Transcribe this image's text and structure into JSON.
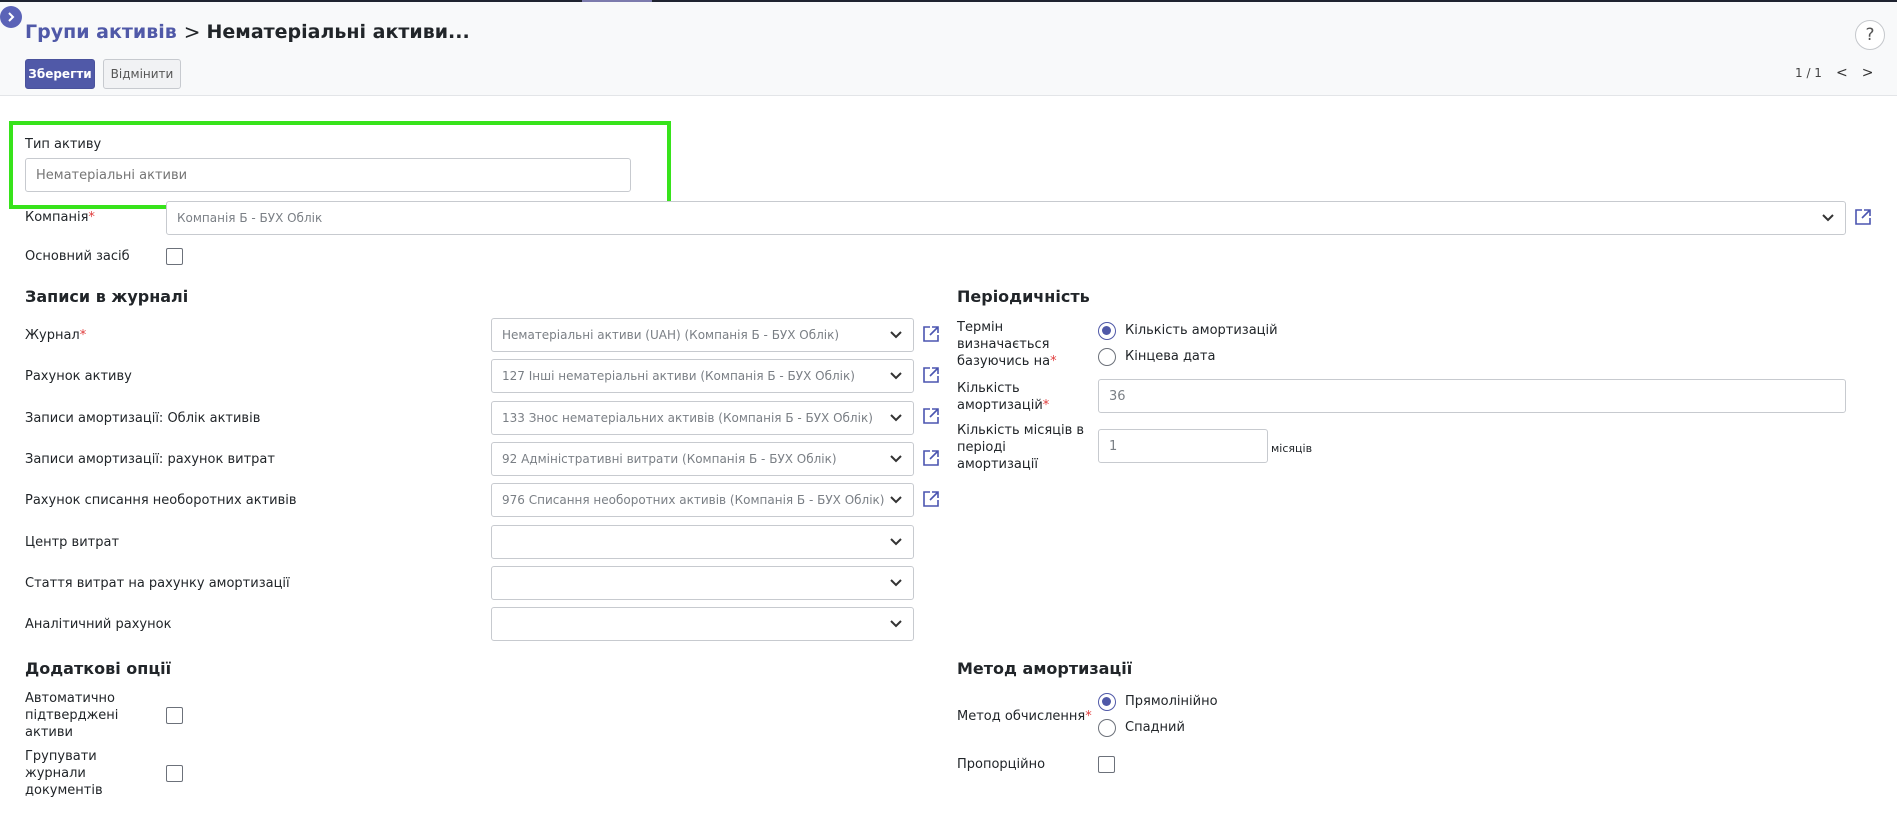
{
  "breadcrumb": {
    "parent": "Групи активів",
    "separator": ">",
    "current": "Нематеріальні активи..."
  },
  "help": "?",
  "toolbar": {
    "save_label": "Зберегти",
    "discard_label": "Відмінити"
  },
  "pager": {
    "value": "1 / 1",
    "prev": "<",
    "next": ">"
  },
  "form": {
    "asset_type": {
      "label": "Тип активу",
      "placeholder": "Нематеріальні активи"
    },
    "company": {
      "label": "Компанія",
      "value": "Компанія Б - БУХ Облік"
    },
    "fixed_asset": {
      "label": "Основний засіб"
    },
    "journal_section": {
      "title": "Записи в журналі",
      "fields": [
        {
          "label": "Журнал",
          "value": "Нематеріальні активи (UAH) (Компанія Б - БУХ Облік)",
          "required": true
        },
        {
          "label": "Рахунок активу",
          "value": "127 Інші нематеріальні активи (Компанія Б - БУХ Облік)"
        },
        {
          "label": "Записи амортизації: Облік активів",
          "value": "133 Знос нематеріальних активів (Компанія Б - БУХ Облік)"
        },
        {
          "label": "Записи амортизації: рахунок витрат",
          "value": "92 Адміністративні витрати (Компанія Б - БУХ Облік)"
        },
        {
          "label": "Рахунок списання необоротних активів",
          "value": "976 Списання необоротних активів (Компанія Б - БУХ Облік)"
        },
        {
          "label": "Центр витрат",
          "value": ""
        },
        {
          "label": "Стаття витрат на рахунку амортизації",
          "value": ""
        },
        {
          "label": "Аналітичний рахунок",
          "value": ""
        }
      ]
    },
    "periodicity": {
      "title": "Періодичність",
      "term_label": "Термін визначається базуючись на",
      "options": [
        "Кількість амортизацій",
        "Кінцева дата"
      ],
      "selected": 0,
      "depreciation_count_label": "Кількість амортизацій",
      "depreciation_count_value": "36",
      "months_label": "Кількість місяців в періоді амортизації",
      "months_value": "1",
      "months_unit": "місяців"
    },
    "additional": {
      "title": "Додаткові опції",
      "auto_confirm_label": "Автоматично підтверджені активи",
      "group_entries_label": "Групувати журнали документів"
    },
    "method": {
      "title": "Метод амортизації",
      "calc_label": "Метод обчислення",
      "options": [
        "Прямолінійно",
        "Спадний"
      ],
      "selected": 0,
      "prorata_label": "Пропорційно"
    }
  },
  "colors": {
    "primary": "#5059a8",
    "highlight": "#37e31b",
    "required": "#e03c3c"
  }
}
